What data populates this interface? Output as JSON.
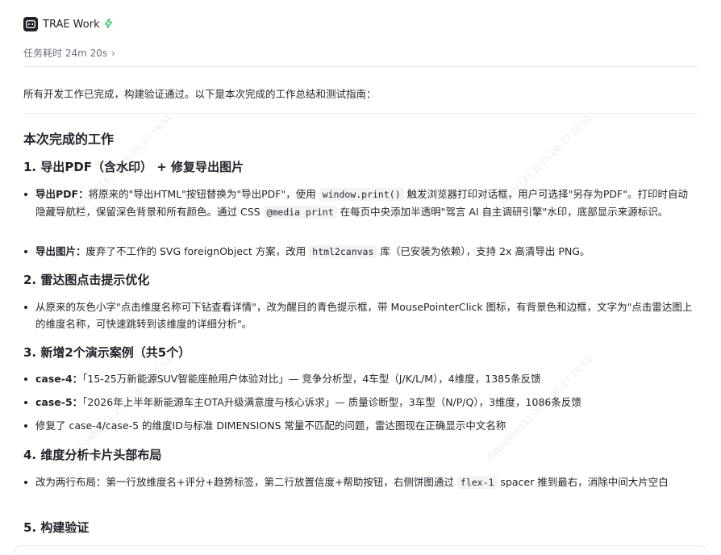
{
  "header": {
    "app_name": "TRAE Work"
  },
  "duration": {
    "label": "任务耗时 24m 20s"
  },
  "intro": "所有开发工作已完成，构建验证通过。以下是本次完成的工作总结和测试指南：",
  "section_title": "本次完成的工作",
  "sec1": {
    "title": "1. 导出PDF（含水印） + 修复导出图片",
    "b1_label": "导出PDF：",
    "b1_text_a": "将原来的\"导出HTML\"按钮替换为\"导出PDF\"，使用 ",
    "b1_code1": "window.print()",
    "b1_text_b": " 触发浏览器打印对话框，用户可选择\"另存为PDF\"。打印时自动隐藏导航栏，保留深色背景和所有颜色。通过 CSS ",
    "b1_code2": "@media print",
    "b1_text_c": " 在每页中央添加半透明\"驾言 AI 自主调研引擎\"水印，底部显示来源标识。",
    "b2_label": "导出图片：",
    "b2_text_a": "废弃了不工作的 SVG foreignObject 方案，改用 ",
    "b2_code": "html2canvas",
    "b2_text_b": " 库（已安装为依赖），支持 2x 高清导出 PNG。"
  },
  "sec2": {
    "title": "2. 雷达图点击提示优化",
    "b1": "从原来的灰色小字\"点击维度名称可下钻查看详情\"，改为醒目的青色提示框，带 MousePointerClick 图标，有背景色和边框，文字为\"点击雷达图上的维度名称，可快速跳转到该维度的详细分析\"。"
  },
  "sec3": {
    "title": "3. 新增2个演示案例（共5个）",
    "b1_label": "case-4：",
    "b1_text": "「15-25万新能源SUV智能座舱用户体验对比」— 竞争分析型，4车型（J/K/L/M），4维度，1385条反馈",
    "b2_label": "case-5：",
    "b2_text": "「2026年上半年新能源车主OTA升级满意度与核心诉求」— 质量诊断型，3车型（N/P/Q），3维度，1086条反馈",
    "b3": "修复了 case-4/case-5 的维度ID与标准 DIMENSIONS 常量不匹配的问题，雷达图现在正确显示中文名称"
  },
  "sec4": {
    "title": "4. 维度分析卡片头部布局",
    "b1_text_a": "改为两行布局：第一行放维度名+评分+趋势标签，第二行放置信度+帮助按钮，右侧饼图通过 ",
    "b1_code": "flex-1",
    "b1_text_b": " spacer 推到最右，消除中间大片空白"
  },
  "sec5": {
    "title": "5. 构建验证"
  }
}
